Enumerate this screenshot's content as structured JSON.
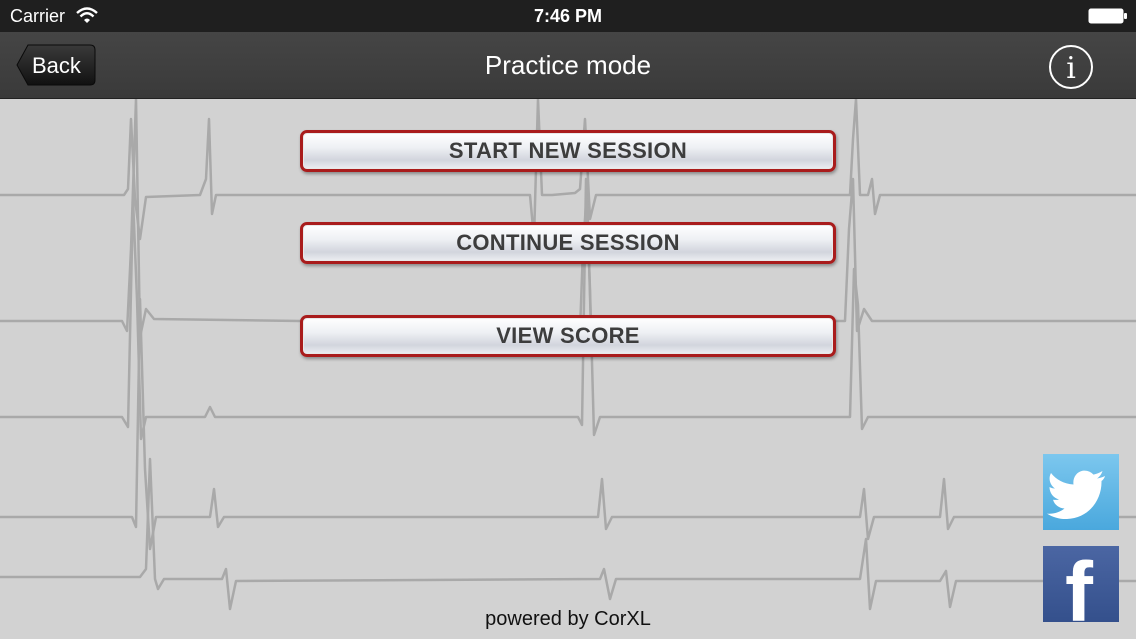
{
  "status_bar": {
    "carrier": "Carrier",
    "time": "7:46 PM"
  },
  "nav": {
    "back_label": "Back",
    "title": "Practice mode",
    "info_glyph": "i"
  },
  "menu": {
    "start_new_session": "START NEW SESSION",
    "continue_session": "CONTINUE SESSION",
    "view_score": "VIEW SCORE"
  },
  "social": {
    "facebook_glyph": "f"
  },
  "footer": {
    "text": "powered by CorXL"
  },
  "colors": {
    "status_bar": "#1f1f1f",
    "nav_bar": "#404040",
    "background": "#d2d2d2",
    "button_border": "#a91c1c",
    "twitter": "#55acee",
    "facebook": "#3b5998"
  },
  "icons": [
    "wifi-icon",
    "battery-icon",
    "back-arrow-icon",
    "info-icon",
    "twitter-bird-icon",
    "facebook-f-icon"
  ]
}
